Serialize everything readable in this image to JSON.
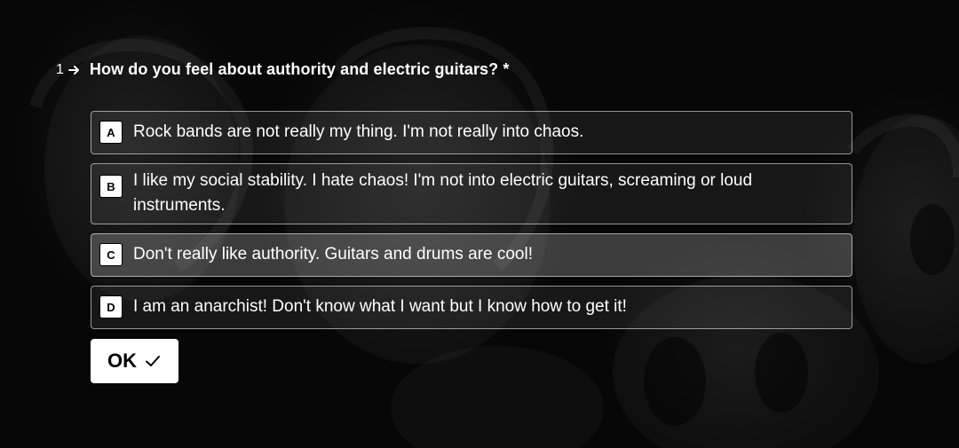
{
  "question": {
    "number": "1",
    "arrow_icon": "arrow-right-icon",
    "text": "How do you feel about authority and electric guitars? *"
  },
  "choices": [
    {
      "key": "A",
      "text": "Rock bands are not really my thing. I'm not really into chaos.",
      "selected": false
    },
    {
      "key": "B",
      "text": "I like my social stability. I hate chaos! I'm not into electric guitars, screaming or loud instruments.",
      "selected": false
    },
    {
      "key": "C",
      "text": "Don't really like authority. Guitars and drums are cool!",
      "selected": true
    },
    {
      "key": "D",
      "text": "I am an anarchist! Don't know what I want but I know how to get it!",
      "selected": false
    }
  ],
  "ok_button": {
    "label": "OK",
    "icon": "check-icon"
  },
  "colors": {
    "background": "#060606",
    "text": "#ffffff",
    "button_bg": "#ffffff",
    "button_text": "#000000"
  }
}
